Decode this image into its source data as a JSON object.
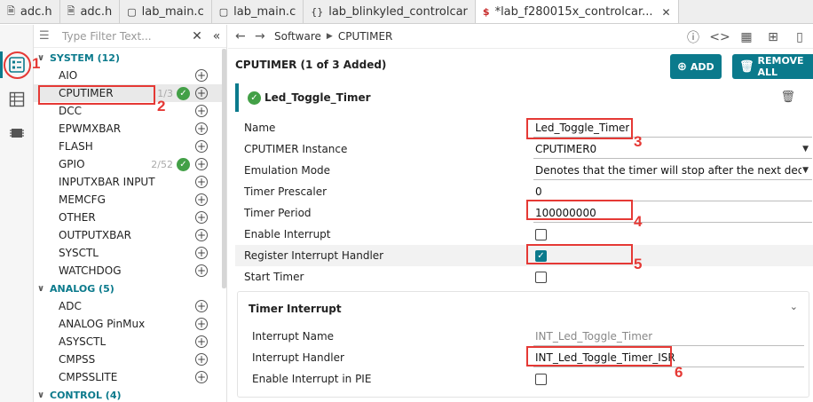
{
  "tabs": [
    {
      "label": "adc.h",
      "icon": "header-file-icon",
      "active": false
    },
    {
      "label": "adc.h",
      "icon": "header-file-icon",
      "active": false
    },
    {
      "label": "lab_main.c",
      "icon": "c-file-icon",
      "active": false
    },
    {
      "label": "lab_main.c",
      "icon": "c-file-icon",
      "active": false
    },
    {
      "label": "lab_blinkyled_controlcar",
      "icon": "braces-file-icon",
      "active": false
    },
    {
      "label": "*lab_f280015x_controlcar...",
      "icon": "syscfg-file-icon",
      "active": true
    }
  ],
  "filter": {
    "placeholder": "Type Filter Text..."
  },
  "tree": {
    "categories": [
      {
        "label": "SYSTEM (12)",
        "items": [
          {
            "label": "AIO",
            "count": "",
            "ok": false
          },
          {
            "label": "CPUTIMER",
            "count": "1/3",
            "ok": true,
            "selected": true
          },
          {
            "label": "DCC",
            "count": "",
            "ok": false
          },
          {
            "label": "EPWMXBAR",
            "count": "",
            "ok": false
          },
          {
            "label": "FLASH",
            "count": "",
            "ok": false
          },
          {
            "label": "GPIO",
            "count": "2/52",
            "ok": true
          },
          {
            "label": "INPUTXBAR INPUT",
            "count": "",
            "ok": false
          },
          {
            "label": "MEMCFG",
            "count": "",
            "ok": false
          },
          {
            "label": "OTHER",
            "count": "",
            "ok": false
          },
          {
            "label": "OUTPUTXBAR",
            "count": "",
            "ok": false
          },
          {
            "label": "SYSCTL",
            "count": "",
            "ok": false
          },
          {
            "label": "WATCHDOG",
            "count": "",
            "ok": false
          }
        ]
      },
      {
        "label": "ANALOG (5)",
        "items": [
          {
            "label": "ADC",
            "count": "",
            "ok": false
          },
          {
            "label": "ANALOG PinMux",
            "count": "",
            "ok": false
          },
          {
            "label": "ASYSCTL",
            "count": "",
            "ok": false
          },
          {
            "label": "CMPSS",
            "count": "",
            "ok": false
          },
          {
            "label": "CMPSSLITE",
            "count": "",
            "ok": false
          }
        ]
      },
      {
        "label": "CONTROL (4)",
        "items": []
      }
    ]
  },
  "breadcrumb": {
    "parent": "Software",
    "current": "CPUTIMER"
  },
  "module": {
    "header": "CPUTIMER (1 of 3 Added)",
    "add_label": "ADD",
    "remove_all_label": "REMOVE ALL",
    "instance_title": "Led_Toggle_Timer"
  },
  "fields": [
    {
      "label": "Name",
      "value": "Led_Toggle_Timer",
      "kind": "text"
    },
    {
      "label": "CPUTIMER Instance",
      "value": "CPUTIMER0",
      "kind": "select"
    },
    {
      "label": "Emulation Mode",
      "value": "Denotes that the timer will stop after the next decr...",
      "kind": "select"
    },
    {
      "label": "Timer Prescaler",
      "value": "0",
      "kind": "text"
    },
    {
      "label": "Timer Period",
      "value": "100000000",
      "kind": "text"
    },
    {
      "label": "Enable Interrupt",
      "value": "",
      "kind": "checkbox",
      "checked": false
    },
    {
      "label": "Register Interrupt Handler",
      "value": "",
      "kind": "checkbox",
      "checked": true
    },
    {
      "label": "Start Timer",
      "value": "",
      "kind": "checkbox",
      "checked": false
    }
  ],
  "timer_interrupt": {
    "title": "Timer Interrupt",
    "fields": [
      {
        "label": "Interrupt Name",
        "value": "INT_Led_Toggle_Timer",
        "kind": "readonly"
      },
      {
        "label": "Interrupt Handler",
        "value": "INT_Led_Toggle_Timer_ISR",
        "kind": "text"
      },
      {
        "label": "Enable Interrupt in PIE",
        "value": "",
        "kind": "checkbox",
        "checked": false
      }
    ]
  },
  "annotations": [
    "1",
    "2",
    "3",
    "4",
    "5",
    "6"
  ],
  "colors": {
    "accent": "#0b7a8c",
    "ok": "#43a047",
    "annotation": "#e53935"
  }
}
